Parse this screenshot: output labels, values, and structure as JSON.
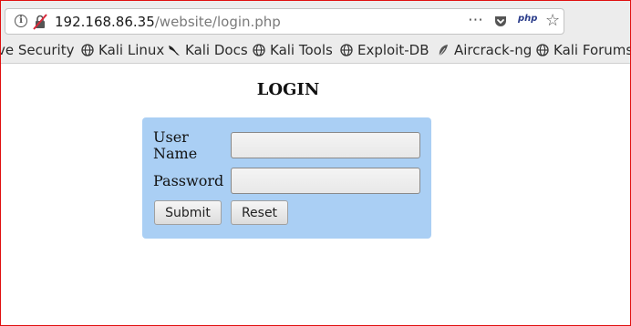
{
  "browser": {
    "url_host": "192.168.86.35",
    "url_path": "/website/login.php",
    "page_actions_icon": "⋯",
    "pocket_icon": "pocket-icon",
    "php_badge": "php",
    "bookmark_star_icon": "☆"
  },
  "bookmarks": [
    {
      "label": "ve Security",
      "icon": "none"
    },
    {
      "label": "Kali Linux",
      "icon": "globe-icon"
    },
    {
      "label": "Kali Docs",
      "icon": "kali-dragon-icon"
    },
    {
      "label": "Kali Tools",
      "icon": "globe-icon"
    },
    {
      "label": "Exploit-DB",
      "icon": "globe-icon"
    },
    {
      "label": "Aircrack-ng",
      "icon": "aircrack-icon"
    },
    {
      "label": "Kali Forums",
      "icon": "globe-icon"
    }
  ],
  "page": {
    "title": "LOGIN",
    "form": {
      "username_label_line1": "User",
      "username_label_line2": "Name",
      "username_value": "",
      "password_label": "Password",
      "password_value": "",
      "submit_label": "Submit",
      "reset_label": "Reset"
    }
  },
  "colors": {
    "form_background": "#aacff4",
    "window_border": "#e01010"
  }
}
